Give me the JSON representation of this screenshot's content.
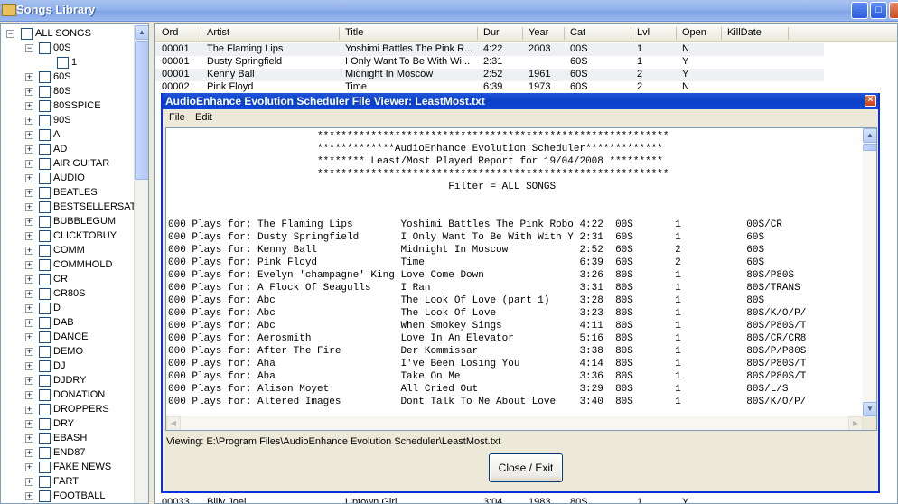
{
  "window": {
    "title": "Songs Library"
  },
  "tree": {
    "items": [
      {
        "label": "ALL SONGS",
        "expander": "−"
      },
      {
        "label": "00S",
        "expander": "−"
      },
      {
        "label": "1",
        "expander": ""
      },
      {
        "label": "60S",
        "expander": "+"
      },
      {
        "label": "80S",
        "expander": "+"
      },
      {
        "label": "80SSPICE",
        "expander": "+"
      },
      {
        "label": "90S",
        "expander": "+"
      },
      {
        "label": "A",
        "expander": "+"
      },
      {
        "label": "AD",
        "expander": "+"
      },
      {
        "label": "AIR GUITAR",
        "expander": "+"
      },
      {
        "label": "AUDIO",
        "expander": "+"
      },
      {
        "label": "BEATLES",
        "expander": "+"
      },
      {
        "label": "BESTSELLERSAT6",
        "expander": "+"
      },
      {
        "label": "BUBBLEGUM",
        "expander": "+"
      },
      {
        "label": "CLICKTOBUY",
        "expander": "+"
      },
      {
        "label": "COMM",
        "expander": "+"
      },
      {
        "label": "COMMHOLD",
        "expander": "+"
      },
      {
        "label": "CR",
        "expander": "+"
      },
      {
        "label": "CR80S",
        "expander": "+"
      },
      {
        "label": "D",
        "expander": "+"
      },
      {
        "label": "DAB",
        "expander": "+"
      },
      {
        "label": "DANCE",
        "expander": "+"
      },
      {
        "label": "DEMO",
        "expander": "+"
      },
      {
        "label": "DJ",
        "expander": "+"
      },
      {
        "label": "DJDRY",
        "expander": "+"
      },
      {
        "label": "DONATION",
        "expander": "+"
      },
      {
        "label": "DROPPERS",
        "expander": "+"
      },
      {
        "label": "DRY",
        "expander": "+"
      },
      {
        "label": "EBASH",
        "expander": "+"
      },
      {
        "label": "END87",
        "expander": "+"
      },
      {
        "label": "FAKE NEWS",
        "expander": "+"
      },
      {
        "label": "FART",
        "expander": "+"
      },
      {
        "label": "FOOTBALL",
        "expander": "+"
      }
    ]
  },
  "grid": {
    "columns": [
      "Ord",
      "Artist",
      "Title",
      "Dur",
      "Year",
      "Cat",
      "Lvl",
      "Open",
      "KillDate"
    ],
    "rows": [
      [
        "00001",
        "The Flaming Lips",
        "Yoshimi Battles The Pink R...",
        "4:22",
        "2003",
        "00S",
        "1",
        "N",
        ""
      ],
      [
        "00001",
        "Dusty Springfield",
        "I Only Want To Be With Wi...",
        "2:31",
        "",
        "60S",
        "1",
        "Y",
        ""
      ],
      [
        "00001",
        "Kenny Ball",
        "Midnight In Moscow",
        "2:52",
        "1961",
        "60S",
        "2",
        "Y",
        ""
      ],
      [
        "00002",
        "Pink Floyd",
        "Time",
        "6:39",
        "1973",
        "60S",
        "2",
        "N",
        ""
      ]
    ],
    "bottom_row": [
      "00033",
      "Billy Joel",
      "Uptown Girl",
      "3:04",
      "1983",
      "80S",
      "1",
      "Y",
      ""
    ]
  },
  "dialog": {
    "title": "AudioEnhance Evolution Scheduler File Viewer: LeastMost.txt",
    "close_glyph": "×",
    "menu": [
      "File",
      "Edit"
    ],
    "report_lines": [
      "                         ***********************************************************",
      "                         *************AudioEnhance Evolution Scheduler*************",
      "                         ******** Least/Most Played Report for 19/04/2008 *********",
      "                         ***********************************************************",
      "                                               Filter = ALL SONGS",
      "",
      "",
      "000 Plays for: The Flaming Lips        Yoshimi Battles The Pink Robo 4:22  00S       1           00S/CR",
      "000 Plays for: Dusty Springfield       I Only Want To Be With With Y 2:31  60S       1           60S",
      "000 Plays for: Kenny Ball              Midnight In Moscow            2:52  60S       2           60S",
      "000 Plays for: Pink Floyd              Time                          6:39  60S       2           60S",
      "000 Plays for: Evelyn 'champagne' King Love Come Down                3:26  80S       1           80S/P80S",
      "000 Plays for: A Flock Of Seagulls     I Ran                         3:31  80S       1           80S/TRANS",
      "000 Plays for: Abc                     The Look Of Love (part 1)     3:28  80S       1           80S",
      "000 Plays for: Abc                     The Look Of Love              3:23  80S       1           80S/K/O/P/",
      "000 Plays for: Abc                     When Smokey Sings             4:11  80S       1           80S/P80S/T",
      "000 Plays for: Aerosmith               Love In An Elevator           5:16  80S       1           80S/CR/CR8",
      "000 Plays for: After The Fire          Der Kommissar                 3:38  80S       1           80S/P/P80S",
      "000 Plays for: Aha                     I've Been Losing You          4:14  80S       1           80S/P80S/T",
      "000 Plays for: Aha                     Take On Me                    3:36  80S       1           80S/P80S/T",
      "000 Plays for: Alison Moyet            All Cried Out                 3:29  80S       1           80S/L/S",
      "000 Plays for: Altered Images          Dont Talk To Me About Love    3:40  80S       1           80S/K/O/P/"
    ],
    "status": "Viewing: E:\\Program Files\\AudioEnhance Evolution Scheduler\\LeastMost.txt",
    "close_button": "Close / Exit"
  }
}
